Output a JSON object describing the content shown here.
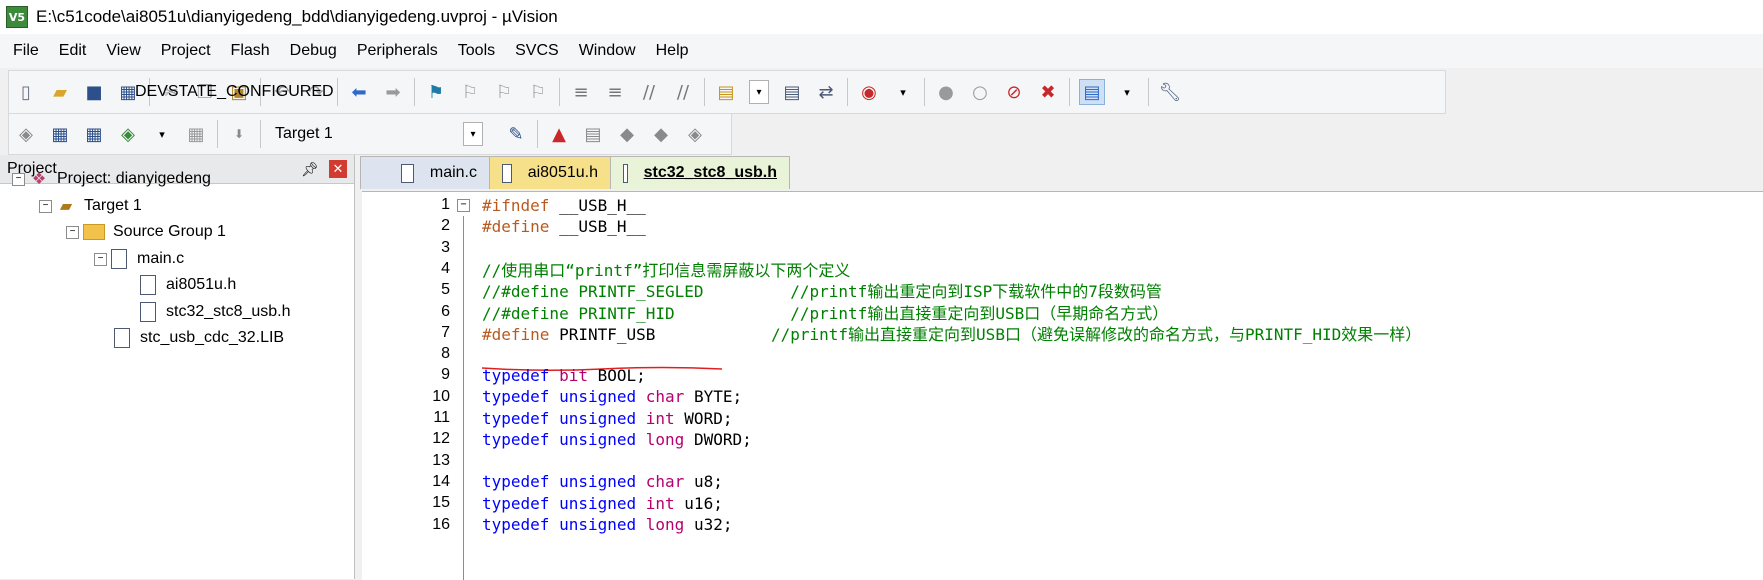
{
  "window": {
    "title": "E:\\c51code\\ai8051u\\dianyigedeng_bdd\\dianyigedeng.uvproj - µVision",
    "app_icon": "V5"
  },
  "menu": [
    "File",
    "Edit",
    "View",
    "Project",
    "Flash",
    "Debug",
    "Peripherals",
    "Tools",
    "SVCS",
    "Window",
    "Help"
  ],
  "toolbar": {
    "config_combo": "DEVSTATE_CONFIGURED",
    "target_combo": "Target 1"
  },
  "project_panel": {
    "title": "Project",
    "tree": [
      {
        "label": "Project: dianyigedeng",
        "kind": "project"
      },
      {
        "label": "Target 1",
        "kind": "target"
      },
      {
        "label": "Source Group 1",
        "kind": "folder"
      },
      {
        "label": "main.c",
        "kind": "file"
      },
      {
        "label": "ai8051u.h",
        "kind": "file"
      },
      {
        "label": "stc32_stc8_usb.h",
        "kind": "file"
      },
      {
        "label": "stc_usb_cdc_32.LIB",
        "kind": "file"
      }
    ]
  },
  "tabs": [
    "main.c",
    "ai8051u.h",
    "stc32_stc8_usb.h"
  ],
  "code": [
    {
      "num": "1",
      "parts": [
        [
          "pp",
          "#ifndef "
        ],
        [
          "id",
          "__USB_H__"
        ]
      ]
    },
    {
      "num": "2",
      "parts": [
        [
          "pp",
          "#define "
        ],
        [
          "id",
          "__USB_H__"
        ]
      ]
    },
    {
      "num": "3",
      "parts": []
    },
    {
      "num": "4",
      "parts": [
        [
          "cm",
          "//使用串口“printf”打印信息需屏蔽以下两个定义"
        ]
      ]
    },
    {
      "num": "5",
      "parts": [
        [
          "cm",
          "//#define PRINTF_SEGLED         //printf输出重定向到ISP下载软件中的7段数码管"
        ]
      ]
    },
    {
      "num": "6",
      "parts": [
        [
          "cm",
          "//#define PRINTF_HID            //printf输出直接重定向到USB口（早期命名方式）"
        ]
      ]
    },
    {
      "num": "7",
      "parts": [
        [
          "pp",
          "#define "
        ],
        [
          "id",
          "PRINTF_USB"
        ],
        [
          "cm",
          "            //printf输出直接重定向到USB口（避免误解修改的命名方式，与PRINTF_HID效果一样）"
        ]
      ]
    },
    {
      "num": "8",
      "parts": []
    },
    {
      "num": "9",
      "parts": [
        [
          "ty",
          "typedef "
        ],
        [
          "bk",
          "bit "
        ],
        [
          "id",
          "BOOL;"
        ]
      ]
    },
    {
      "num": "10",
      "parts": [
        [
          "ty",
          "typedef "
        ],
        [
          "kw",
          "unsigned "
        ],
        [
          "bk",
          "char "
        ],
        [
          "id",
          "BYTE;"
        ]
      ]
    },
    {
      "num": "11",
      "parts": [
        [
          "ty",
          "typedef "
        ],
        [
          "kw",
          "unsigned "
        ],
        [
          "bk",
          "int "
        ],
        [
          "id",
          "WORD;"
        ]
      ]
    },
    {
      "num": "12",
      "parts": [
        [
          "ty",
          "typedef "
        ],
        [
          "kw",
          "unsigned "
        ],
        [
          "bk",
          "long "
        ],
        [
          "id",
          "DWORD;"
        ]
      ]
    },
    {
      "num": "13",
      "parts": []
    },
    {
      "num": "14",
      "parts": [
        [
          "ty",
          "typedef "
        ],
        [
          "kw",
          "unsigned "
        ],
        [
          "bk",
          "char "
        ],
        [
          "id",
          "u8;"
        ]
      ]
    },
    {
      "num": "15",
      "parts": [
        [
          "ty",
          "typedef "
        ],
        [
          "kw",
          "unsigned "
        ],
        [
          "bk",
          "int "
        ],
        [
          "id",
          "u16;"
        ]
      ]
    },
    {
      "num": "16",
      "parts": [
        [
          "ty",
          "typedef "
        ],
        [
          "kw",
          "unsigned "
        ],
        [
          "bk",
          "long "
        ],
        [
          "id",
          "u32;"
        ]
      ]
    }
  ]
}
